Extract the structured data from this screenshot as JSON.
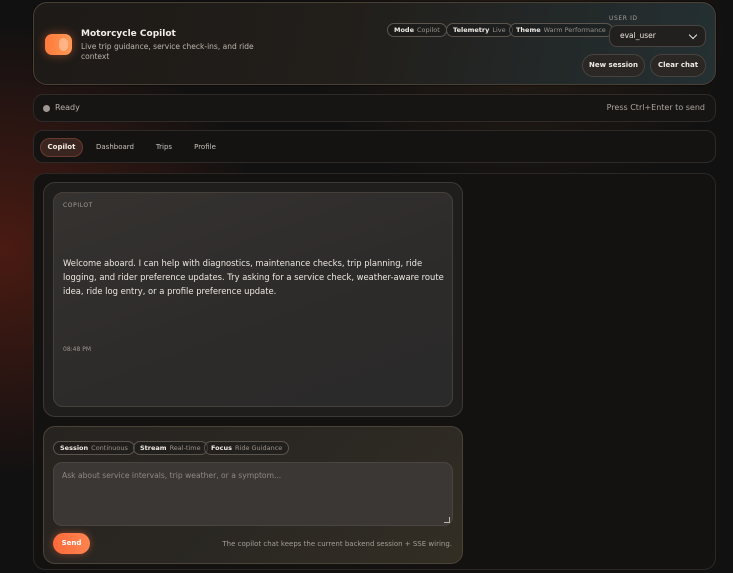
{
  "header": {
    "title": "Motorcycle Copilot",
    "subtitle": "Live trip guidance, service check-ins, and ride context",
    "chips": [
      {
        "key": "Mode",
        "value": "Copilot"
      },
      {
        "key": "Telemetry",
        "value": "Live"
      },
      {
        "key": "Theme",
        "value": "Warm Performance"
      }
    ],
    "user_id_label": "USER ID",
    "user_id_value": "eval_user",
    "new_session_label": "New session",
    "clear_chat_label": "Clear chat"
  },
  "status": {
    "text": "Ready",
    "hint": "Press Ctrl+Enter to send"
  },
  "tabs": [
    {
      "label": "Copilot",
      "active": true
    },
    {
      "label": "Dashboard",
      "active": false
    },
    {
      "label": "Trips",
      "active": false
    },
    {
      "label": "Profile",
      "active": false
    }
  ],
  "chat": {
    "messages": [
      {
        "author": "COPILOT",
        "text": "Welcome aboard. I can help with diagnostics, maintenance checks, trip planning, ride logging, and rider preference updates. Try asking for a service check, weather-aware route idea, ride log entry, or a profile preference update.",
        "time": "08:48 PM"
      }
    ]
  },
  "composer": {
    "chips": [
      {
        "key": "Session",
        "value": "Continuous"
      },
      {
        "key": "Stream",
        "value": "Real-time"
      },
      {
        "key": "Focus",
        "value": "Ride Guidance"
      }
    ],
    "placeholder": "Ask about service intervals, trip weather, or a symptom...",
    "send_label": "Send",
    "footnote": "The copilot chat keeps the current backend session + SSE wiring."
  },
  "colors": {
    "accent": "#ff7a3c",
    "background": "#121111"
  }
}
